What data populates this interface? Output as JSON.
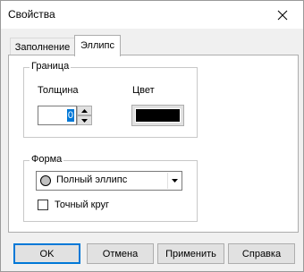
{
  "window": {
    "title": "Свойства"
  },
  "tabs": [
    {
      "label": "Заполнение",
      "active": false
    },
    {
      "label": "Эллипс",
      "active": true
    }
  ],
  "border_group": {
    "legend": "Граница",
    "thickness_label": "Толщина",
    "thickness_value": "0",
    "color_label": "Цвет",
    "color_value": "#000000"
  },
  "shape_group": {
    "legend": "Форма",
    "shape_selected": "Полный эллипс",
    "exact_circle_label": "Точный круг",
    "exact_circle_checked": false
  },
  "buttons": {
    "ok": "OK",
    "cancel": "Отмена",
    "apply": "Применить",
    "help": "Справка"
  },
  "icons": {
    "close": "close-icon",
    "spin_up": "arrow-up-icon",
    "spin_down": "arrow-down-icon",
    "dropdown": "chevron-down-icon",
    "shape_preview": "ellipse-shape-icon"
  }
}
